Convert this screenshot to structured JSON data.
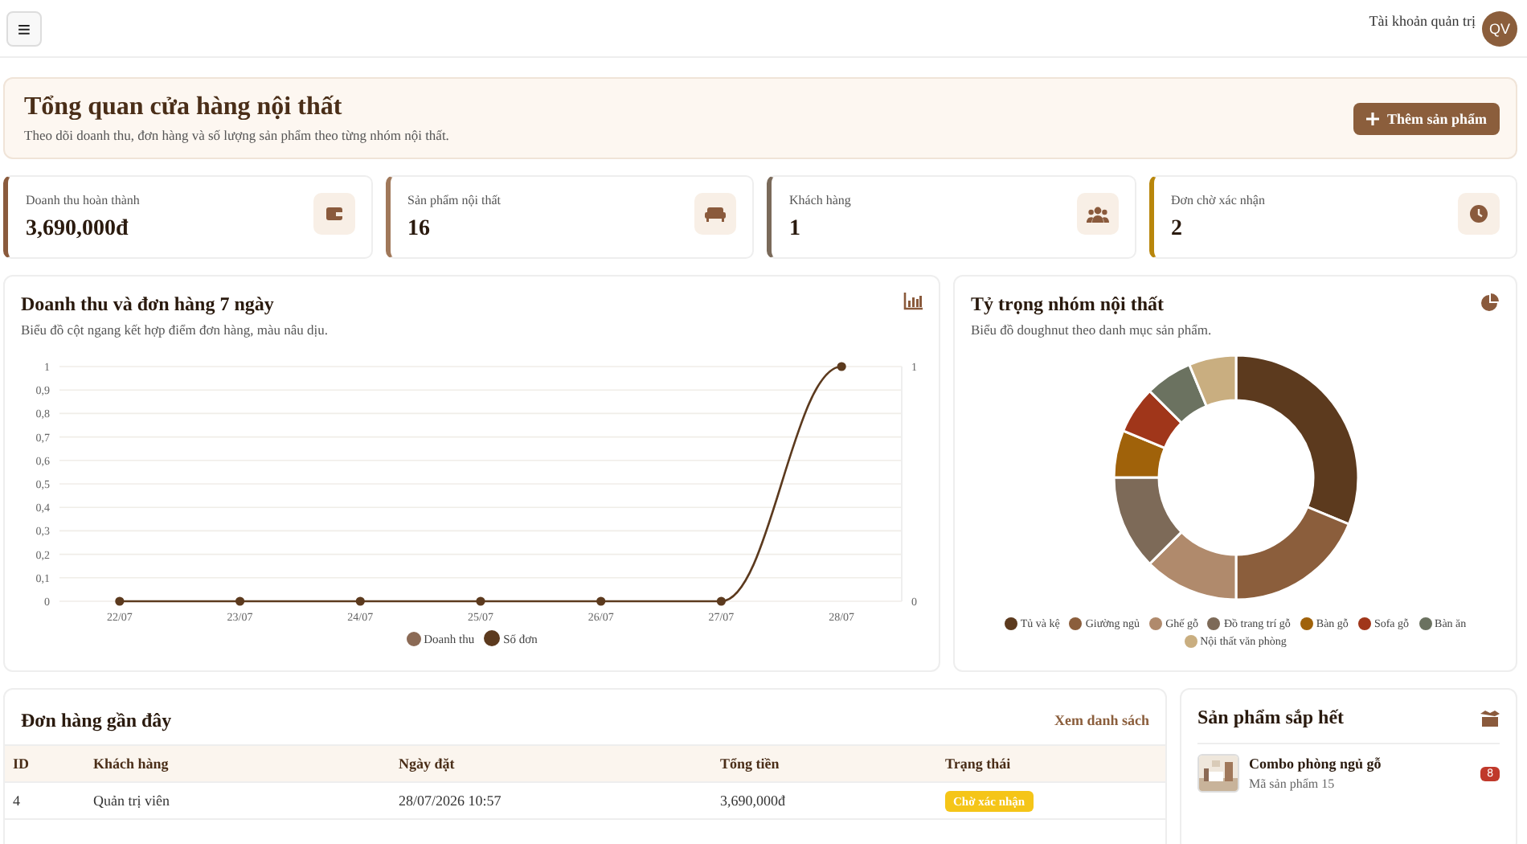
{
  "topbar": {
    "menu_icon": "≡",
    "account_label": "Tài khoản quản trị",
    "avatar": "QV"
  },
  "hero": {
    "title": "Tổng quan cửa hàng nội thất",
    "subtitle": "Theo dõi doanh thu, đơn hàng và số lượng sản phẩm theo từng nhóm nội thất.",
    "button": "Thêm sản phẩm"
  },
  "stats": [
    {
      "label": "Doanh thu hoàn thành",
      "value": "3,690,000đ",
      "kind": "wallet",
      "color": "#8a5a3c"
    },
    {
      "label": "Sản phẩm nội thất",
      "value": "16",
      "kind": "sofa",
      "color": "#a0785a"
    },
    {
      "label": "Khách hàng",
      "value": "1",
      "kind": "users",
      "color": "#7a6a5a"
    },
    {
      "label": "Đơn chờ xác nhận",
      "value": "2",
      "kind": "clock",
      "color": "#b8860b"
    }
  ],
  "revenue_chart": {
    "title": "Doanh thu và đơn hàng 7 ngày",
    "subtitle": "Biểu đồ cột ngang kết hợp điểm đơn hàng, màu nâu dịu.",
    "chart_data": {
      "type": "line",
      "categories": [
        "22/07",
        "23/07",
        "24/07",
        "25/07",
        "26/07",
        "27/07",
        "28/07"
      ],
      "series": [
        {
          "name": "Doanh thu",
          "type": "bar",
          "color": "#8b6a55",
          "values": [
            0,
            0,
            0,
            0,
            0,
            0,
            0
          ]
        },
        {
          "name": "Số đơn",
          "type": "line",
          "marker": "circle",
          "color": "#5c3a1e",
          "values": [
            0,
            0,
            0,
            0,
            0,
            0,
            1
          ]
        }
      ],
      "grid": true,
      "legend": "bottom",
      "y2lim": [
        0,
        1
      ],
      "ylim": [
        0,
        1
      ],
      "yticks": [
        0,
        {
          "value": 0.1,
          "label": "0,1"
        },
        {
          "value": 0.2,
          "label": "0,2"
        },
        {
          "value": 0.3,
          "label": "0,3"
        },
        {
          "value": 0.4,
          "label": "0,4"
        },
        {
          "value": 0.5,
          "label": "0,5"
        },
        {
          "value": 0.6,
          "label": "0,6"
        },
        {
          "value": 0.7,
          "label": "0,7"
        },
        {
          "value": 0.8,
          "label": "0,8"
        },
        {
          "value": 0.9,
          "label": "0,9"
        },
        1
      ],
      "y2ticks": [
        0,
        1
      ]
    }
  },
  "category_chart": {
    "title": "Tỷ trọng nhóm nội thất",
    "subtitle": "Biểu đồ doughnut theo danh mục sản phẩm.",
    "chart_data": {
      "type": "donut",
      "categories": [
        "Tủ và kệ",
        "Giường ngủ",
        "Ghế gỗ",
        "Đồ trang trí gỗ",
        "Bàn gỗ",
        "Sofa gỗ",
        "Bàn ăn",
        "Nội thất văn phòng"
      ],
      "series": [
        {
          "values": [
            31.25,
            18.75,
            12.5,
            12.5,
            6.25,
            6.25,
            6.25,
            6.25
          ]
        }
      ],
      "legend": "bottom",
      "colors": [
        "#5c3a1e",
        "#8b5e3c",
        "#b08a6c",
        "#7d6a58",
        "#a0620a",
        "#a0361a",
        "#6b7260",
        "#c9ae80"
      ]
    }
  },
  "orders": {
    "title": "Đơn hàng gần đây",
    "link": "Xem danh sách",
    "columns": [
      "ID",
      "Khách hàng",
      "Ngày đặt",
      "Tổng tiền",
      "Trạng thái"
    ],
    "rows": [
      {
        "id": "4",
        "customer": "Quản trị viên",
        "date": "28/07/2026 10:57",
        "total": "3,690,000đ",
        "status": "Chờ xác nhận",
        "color": "#f5c518"
      }
    ]
  },
  "low_stock": {
    "title": "Sản phẩm sắp hết",
    "items": [
      {
        "name": "Combo phòng ngủ gỗ",
        "code": "Mã sản phẩm 15",
        "count": "8"
      }
    ]
  }
}
